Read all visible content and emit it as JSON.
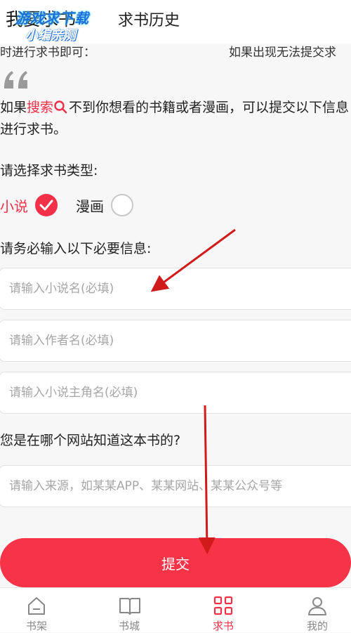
{
  "header": {
    "tabs": [
      {
        "label": "我要求书",
        "active": true
      },
      {
        "label": "求书历史",
        "active": false
      }
    ],
    "watermark": {
      "line1": "游戏求下载",
      "line2": "小编亲测"
    }
  },
  "clipped_lines": {
    "left": "时进行求书即可：",
    "right": "如果出现无法提交求"
  },
  "intro": {
    "before": "如果",
    "search_word": "搜索",
    "after": "不到你想看的书籍或者漫画，可以提交以下信息进行求书。"
  },
  "type_section": {
    "label": "请选择求书类型:",
    "options": [
      {
        "label": "小说",
        "selected": true
      },
      {
        "label": "漫画",
        "selected": false
      }
    ]
  },
  "required_label": "请务必输入以下必要信息:",
  "fields": {
    "book_name_placeholder": "请输入小说名(必填)",
    "author_placeholder": "请输入作者名(必填)",
    "protagonist_placeholder": "请输入小说主角名(必填)",
    "source_placeholder": "请输入来源，如某某APP、某某网站、某某公众号等"
  },
  "source_label": "您是在哪个网站知道这本书的?",
  "submit_label": "提交",
  "bottom_nav": [
    {
      "label": "书架",
      "icon": "bookshelf-icon",
      "active": false
    },
    {
      "label": "书城",
      "icon": "book-icon",
      "active": false
    },
    {
      "label": "求书",
      "icon": "grid-icon",
      "active": true
    },
    {
      "label": "我的",
      "icon": "user-icon",
      "active": false
    }
  ],
  "colors": {
    "accent": "#f23048",
    "annotation_arrow": "#d11a1a"
  }
}
